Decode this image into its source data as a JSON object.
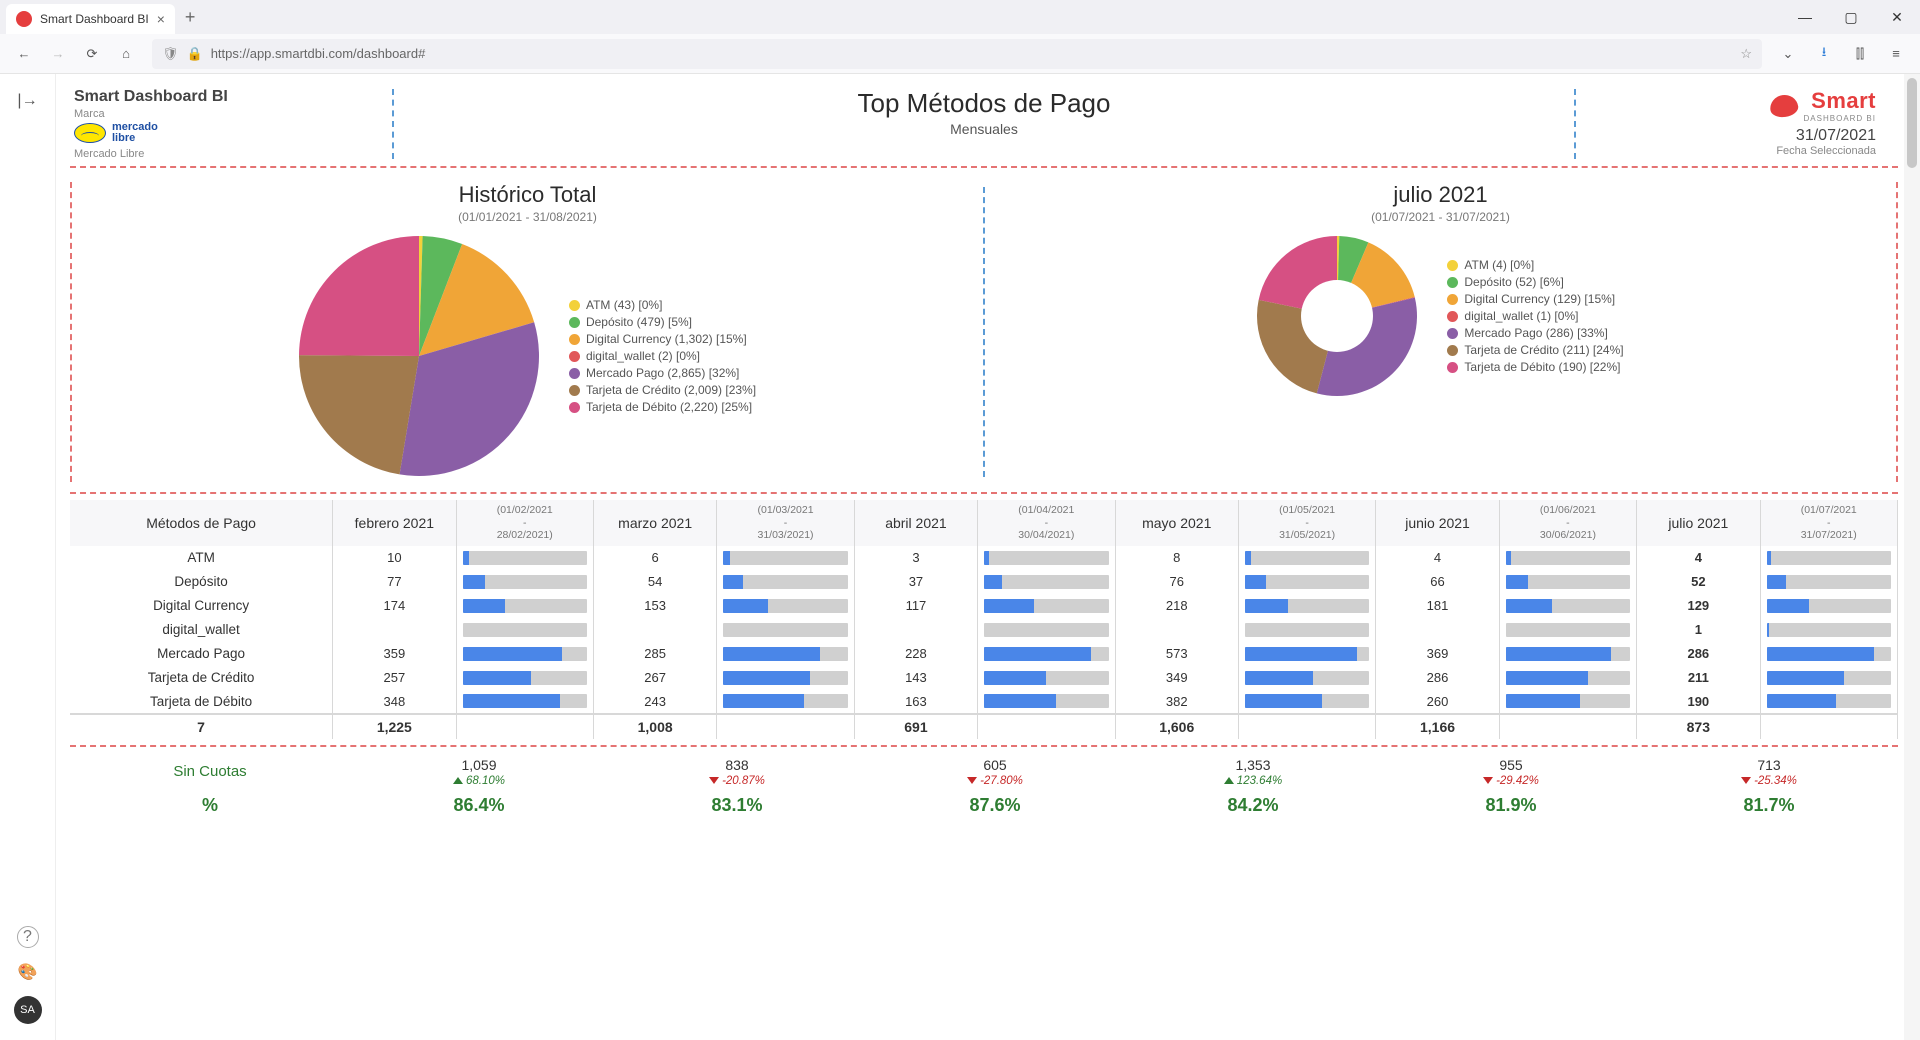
{
  "browser": {
    "tab_title": "Smart Dashboard BI",
    "url": "https://app.smartdbi.com/dashboard#"
  },
  "rail": {
    "avatar": "SA"
  },
  "header": {
    "app_name": "Smart Dashboard BI",
    "brand_label": "Marca",
    "brand_name": "Mercado Libre",
    "ml_line1": "mercado",
    "ml_line2": "libre",
    "title": "Top Métodos de Pago",
    "subtitle": "Mensuales",
    "logo_text": "Smart",
    "logo_sub": "DASHBOARD BI",
    "date": "31/07/2021",
    "date_label": "Fecha Seleccionada"
  },
  "chart_data": [
    {
      "type": "pie",
      "title": "Histórico Total",
      "range": "(01/01/2021 - 31/08/2021)",
      "series": [
        {
          "name": "ATM",
          "value": 43,
          "pct": 0,
          "color": "#f3d13a",
          "label": "ATM (43) [0%]"
        },
        {
          "name": "Depósito",
          "value": 479,
          "pct": 5,
          "color": "#5cb85c",
          "label": "Depósito (479) [5%]"
        },
        {
          "name": "Digital Currency",
          "value": 1302,
          "pct": 15,
          "color": "#f0a537",
          "label": "Digital Currency (1,302) [15%]"
        },
        {
          "name": "digital_wallet",
          "value": 2,
          "pct": 0,
          "color": "#e15759",
          "label": "digital_wallet (2) [0%]"
        },
        {
          "name": "Mercado Pago",
          "value": 2865,
          "pct": 32,
          "color": "#8a5ea6",
          "label": "Mercado Pago (2,865) [32%]"
        },
        {
          "name": "Tarjeta de Crédito",
          "value": 2009,
          "pct": 23,
          "color": "#a17a4d",
          "label": "Tarjeta de Crédito (2,009) [23%]"
        },
        {
          "name": "Tarjeta de Débito",
          "value": 2220,
          "pct": 25,
          "color": "#d65083",
          "label": "Tarjeta de Débito (2,220) [25%]"
        }
      ]
    },
    {
      "type": "donut",
      "title": "julio 2021",
      "range": "(01/07/2021 - 31/07/2021)",
      "series": [
        {
          "name": "ATM",
          "value": 4,
          "pct": 0,
          "color": "#f3d13a",
          "label": "ATM (4) [0%]"
        },
        {
          "name": "Depósito",
          "value": 52,
          "pct": 6,
          "color": "#5cb85c",
          "label": "Depósito (52) [6%]"
        },
        {
          "name": "Digital Currency",
          "value": 129,
          "pct": 15,
          "color": "#f0a537",
          "label": "Digital Currency (129) [15%]"
        },
        {
          "name": "digital_wallet",
          "value": 1,
          "pct": 0,
          "color": "#e15759",
          "label": "digital_wallet (1) [0%]"
        },
        {
          "name": "Mercado Pago",
          "value": 286,
          "pct": 33,
          "color": "#8a5ea6",
          "label": "Mercado Pago (286) [33%]"
        },
        {
          "name": "Tarjeta de Crédito",
          "value": 211,
          "pct": 24,
          "color": "#a17a4d",
          "label": "Tarjeta de Crédito (211) [24%]"
        },
        {
          "name": "Tarjeta de Débito",
          "value": 190,
          "pct": 22,
          "color": "#d65083",
          "label": "Tarjeta de Débito (190) [22%]"
        }
      ]
    }
  ],
  "table": {
    "method_header": "Métodos de Pago",
    "months": [
      {
        "label": "febrero 2021",
        "range": "(01/02/2021 - 28/02/2021)"
      },
      {
        "label": "marzo 2021",
        "range": "(01/03/2021 - 31/03/2021)"
      },
      {
        "label": "abril 2021",
        "range": "(01/04/2021 - 30/04/2021)"
      },
      {
        "label": "mayo 2021",
        "range": "(01/05/2021 - 31/05/2021)"
      },
      {
        "label": "junio 2021",
        "range": "(01/06/2021 - 30/06/2021)"
      },
      {
        "label": "julio 2021",
        "range": "(01/07/2021 - 31/07/2021)"
      }
    ],
    "rows": [
      {
        "method": "ATM",
        "v": [
          10,
          6,
          3,
          8,
          4,
          4
        ],
        "b": [
          5,
          5,
          4,
          5,
          4,
          4
        ]
      },
      {
        "method": "Depósito",
        "v": [
          77,
          54,
          37,
          76,
          66,
          52
        ],
        "b": [
          18,
          16,
          14,
          17,
          18,
          16
        ]
      },
      {
        "method": "Digital Currency",
        "v": [
          174,
          153,
          117,
          218,
          181,
          129
        ],
        "b": [
          34,
          36,
          40,
          35,
          37,
          34
        ]
      },
      {
        "method": "digital_wallet",
        "v": [
          "",
          "",
          "",
          "",
          "",
          1
        ],
        "b": [
          0,
          0,
          0,
          0,
          0,
          2
        ]
      },
      {
        "method": "Mercado Pago",
        "v": [
          359,
          285,
          228,
          573,
          369,
          286
        ],
        "b": [
          80,
          78,
          86,
          90,
          85,
          86
        ]
      },
      {
        "method": "Tarjeta de Crédito",
        "v": [
          257,
          267,
          143,
          349,
          286,
          211
        ],
        "b": [
          55,
          70,
          50,
          55,
          66,
          62
        ]
      },
      {
        "method": "Tarjeta de Débito",
        "v": [
          348,
          243,
          163,
          382,
          260,
          190
        ],
        "b": [
          78,
          65,
          58,
          62,
          60,
          56
        ]
      }
    ],
    "totals": {
      "method_count": 7,
      "v": [
        "1,225",
        "1,008",
        "691",
        "1,606",
        "1,166",
        "873"
      ]
    }
  },
  "quotas": {
    "label": "Sin Cuotas",
    "pct_label": "%",
    "cells": [
      {
        "value": "1,059",
        "delta": "68.10%",
        "dir": "up",
        "pct": "86.4%"
      },
      {
        "value": "838",
        "delta": "-20.87%",
        "dir": "down",
        "pct": "83.1%"
      },
      {
        "value": "605",
        "delta": "-27.80%",
        "dir": "down",
        "pct": "87.6%"
      },
      {
        "value": "1,353",
        "delta": "123.64%",
        "dir": "up",
        "pct": "84.2%"
      },
      {
        "value": "955",
        "delta": "-29.42%",
        "dir": "down",
        "pct": "81.9%"
      },
      {
        "value": "713",
        "delta": "-25.34%",
        "dir": "down",
        "pct": "81.7%"
      }
    ]
  }
}
